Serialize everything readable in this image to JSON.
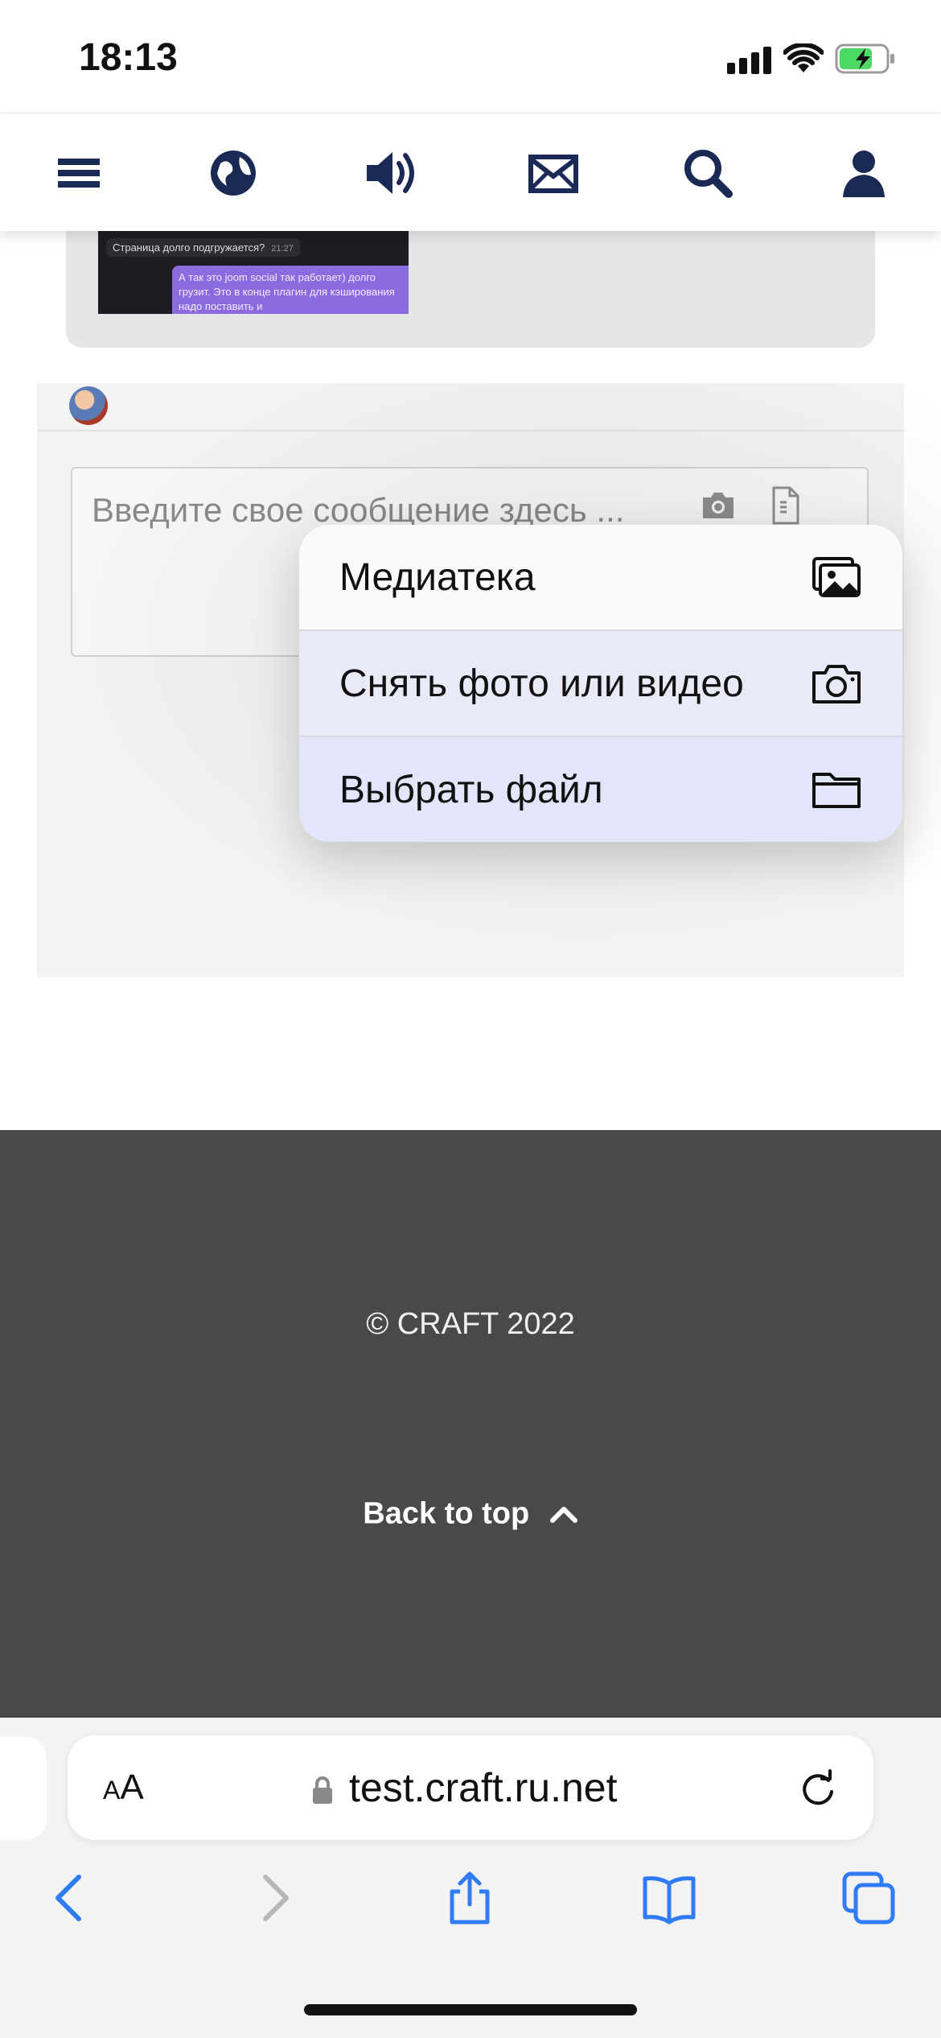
{
  "status_bar": {
    "time": "18:13",
    "battery_charging": true
  },
  "nav": {
    "icons": [
      "menu-icon",
      "globe-icon",
      "speaker-icon",
      "mail-icon",
      "search-icon",
      "user-icon"
    ]
  },
  "preview": {
    "incoming_message": "Страница долго подгружается?",
    "incoming_time": "21:27",
    "outgoing_message": "А так это joom social так работает) долго грузит. Это в конце плагин для кэширования надо поставить и"
  },
  "composer": {
    "placeholder": "Введите свое сообщение здесь ...",
    "camera_icon": "camera-icon",
    "file_icon": "file-icon"
  },
  "attach_menu": {
    "items": [
      {
        "label": "Медиатека",
        "icon": "photo-library-icon"
      },
      {
        "label": "Снять фото или видео",
        "icon": "camera-icon"
      },
      {
        "label": "Выбрать файл",
        "icon": "folder-icon"
      }
    ]
  },
  "footer": {
    "copyright": "© CRAFT 2022",
    "back_to_top": "Back to top"
  },
  "browser": {
    "text_size_small": "A",
    "text_size_large": "A",
    "url": "test.craft.ru.net",
    "toolbar_icons": [
      "back-icon",
      "forward-icon",
      "share-icon",
      "bookmarks-icon",
      "tabs-icon"
    ]
  },
  "colors": {
    "nav_icon": "#1b2a55",
    "footer_bg": "#494949",
    "menu_highlight": "#e3e6fb",
    "browser_accent": "#2f7cf6"
  }
}
